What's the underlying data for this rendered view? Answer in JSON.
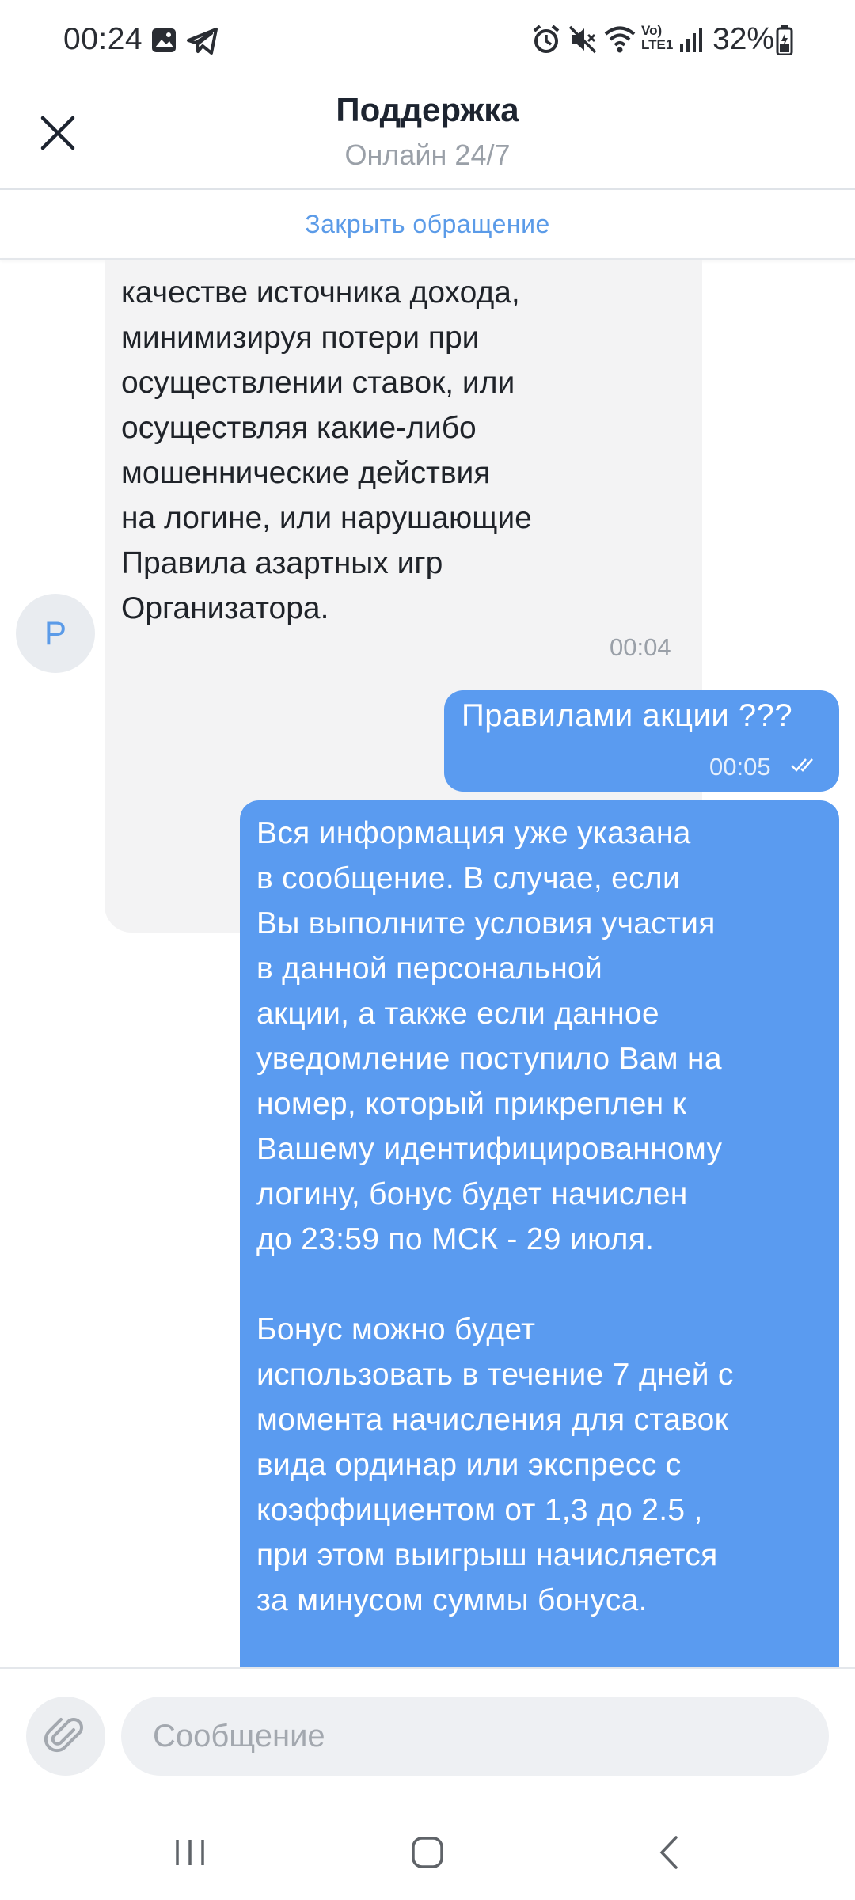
{
  "status_bar": {
    "time": "00:24",
    "battery": "32%",
    "volte_label_top": "Vo)",
    "volte_label_bottom": "LTE1"
  },
  "header": {
    "title": "Поддержка",
    "subtitle": "Онлайн 24/7"
  },
  "close_ticket_label": "Закрыть обращение",
  "messages": [
    {
      "direction": "incoming",
      "text": "качестве источника дохода, минимизируя потери при осуществлении ставок, или осуществляя какие-либо мошеннические действия на логине, или нарушающие Правила азартных игр Организатора.",
      "lines": [
        "качестве источника дохода,",
        "минимизируя потери при",
        "осуществлении ставок, или",
        "осуществляя какие-либо",
        "мошеннические действия",
        "на логине, или нарушающие",
        "Правила азартных игр",
        "Организатора."
      ],
      "time": "00:04",
      "avatar_letter": "P"
    },
    {
      "direction": "outgoing",
      "text": "Правилами акции ???",
      "time": "00:05",
      "status": "read"
    },
    {
      "direction": "outgoing",
      "text": "Вся информация уже указана\nв сообщение. В случае, если\nВы выполните условия участия\nв данной персональной\nакции, а также если данное\nуведомление поступило Вам на\nномер, который прикреплен к\nВашему идентифицированному\nлогину, бонус будет начислен\nдо 23:59 по МСК - 29 июля.\n\nБонус можно будет\nиспользовать в течение 7 дней с\nмомента начисления для ставок\nвида ординар или экспресс с\nкоэффициентом от 1,3 до 2.5 ,\nпри этом выигрыш начисляется\nза минусом суммы бонуса."
    }
  ],
  "composer": {
    "placeholder": "Сообщение"
  },
  "icons": {
    "close": "close-icon",
    "attach": "paperclip-icon",
    "nav_recents": "recents-icon",
    "nav_home": "home-icon",
    "nav_back": "back-icon"
  },
  "colors": {
    "accent": "#5a9bf0",
    "link": "#5b9be8",
    "incoming_bubble": "#f3f3f4"
  }
}
